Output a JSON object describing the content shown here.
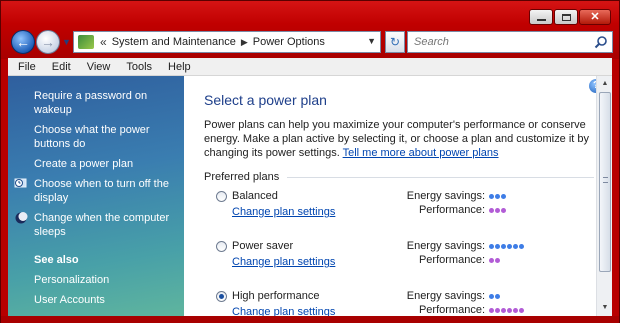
{
  "window": {
    "colors": {
      "frame": "#b80000",
      "sidebar_top": "#2f5f9e",
      "sidebar_bottom": "#5fb59e",
      "link": "#0045b0",
      "title": "#1e3f8a"
    }
  },
  "nav": {
    "breadcrumbs": [
      "System and Maintenance",
      "Power Options"
    ],
    "back_glyph": "←",
    "forward_glyph": "→",
    "sep_glyph": "«",
    "refresh_glyph": "↻",
    "search_placeholder": "Search"
  },
  "menu": [
    "File",
    "Edit",
    "View",
    "Tools",
    "Help"
  ],
  "sidebar": {
    "links": [
      {
        "label": "Require a password on wakeup",
        "icon": ""
      },
      {
        "label": "Choose what the power buttons do",
        "icon": ""
      },
      {
        "label": "Create a power plan",
        "icon": ""
      },
      {
        "label": "Choose when to turn off the display",
        "icon": "monitor-clock-icon"
      },
      {
        "label": "Change when the computer sleeps",
        "icon": "moon-icon"
      }
    ],
    "see_also_heading": "See also",
    "see_also": [
      "Personalization",
      "User Accounts"
    ]
  },
  "main": {
    "help_glyph": "?",
    "title": "Select a power plan",
    "intro": "Power plans can help you maximize your computer's performance or conserve energy. Make a plan active by selecting it, or choose a plan and customize it by changing its power settings.",
    "intro_link": "Tell me more about power plans",
    "section_label": "Preferred plans",
    "energy_label": "Energy savings:",
    "performance_label": "Performance:",
    "change_label": "Change plan settings",
    "plans": [
      {
        "name": "Balanced",
        "selected": false,
        "energy_savings": 3,
        "performance": 3
      },
      {
        "name": "Power saver",
        "selected": false,
        "energy_savings": 6,
        "performance": 2
      },
      {
        "name": "High performance",
        "selected": true,
        "energy_savings": 2,
        "performance": 6
      }
    ],
    "energy_color": "#3e7de6",
    "performance_color": "#b25cd6"
  }
}
